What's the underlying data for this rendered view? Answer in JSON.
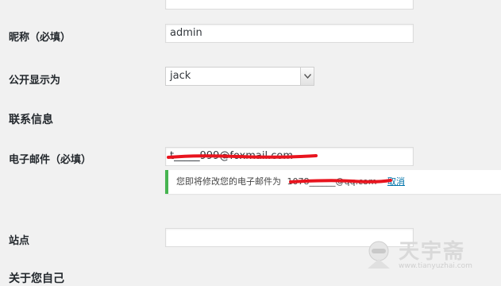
{
  "top_input": {
    "value": ""
  },
  "nickname": {
    "label": "昵称（必填）",
    "value": "admin"
  },
  "display_name": {
    "label": "公开显示为",
    "selected": "jack"
  },
  "contact_section": {
    "title": "联系信息"
  },
  "email": {
    "label": "电子邮件（必填）",
    "value": "t_____999@foxmail.com",
    "notice_text": "您即将修改您的电子邮件为",
    "notice_value": "1078______@qq.com",
    "cancel_label": "取消"
  },
  "website": {
    "label": "站点",
    "value": ""
  },
  "about_section": {
    "title": "关于您自己"
  },
  "watermark": {
    "brand": "天宇斋",
    "url": "www.tianyuzhai.com"
  },
  "colors": {
    "redaction": "#e8141e",
    "success": "#46b450",
    "link": "#0073aa"
  }
}
